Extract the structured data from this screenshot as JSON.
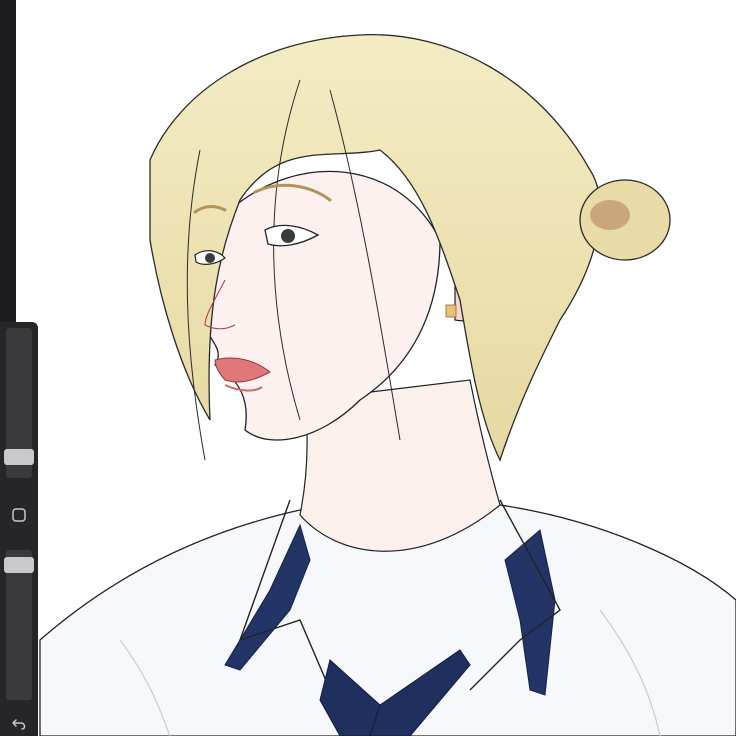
{
  "app": {
    "colors": {
      "toolbar_bg": "#262628",
      "slider_track": "#3a3a3d",
      "slider_thumb": "#c9c9cb",
      "canvas_bg": "#ffffff"
    }
  },
  "sidebar": {
    "brush_size_level": 0.1,
    "opacity_level": 0.95,
    "modify_icon": "square-outline-icon",
    "undo_icon": "undo-arrow-icon"
  },
  "canvas": {
    "artwork": "painted-portrait"
  }
}
